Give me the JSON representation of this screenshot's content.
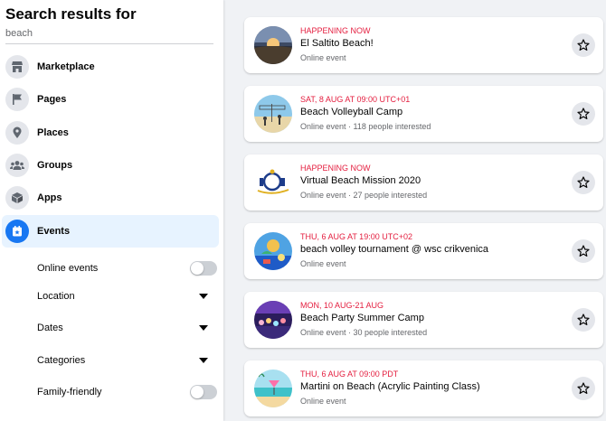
{
  "sidebar": {
    "title": "Search results for",
    "query": "beach",
    "nav": [
      {
        "label": "Marketplace",
        "icon": "store-icon"
      },
      {
        "label": "Pages",
        "icon": "flag-icon"
      },
      {
        "label": "Places",
        "icon": "map-pin-icon"
      },
      {
        "label": "Groups",
        "icon": "groups-icon"
      },
      {
        "label": "Apps",
        "icon": "cube-icon"
      },
      {
        "label": "Events",
        "icon": "calendar-star-icon",
        "active": true
      }
    ],
    "filters": {
      "online_events": {
        "label": "Online events",
        "toggle": false
      },
      "location": {
        "label": "Location"
      },
      "dates": {
        "label": "Dates"
      },
      "categories": {
        "label": "Categories"
      },
      "family_friendly": {
        "label": "Family-friendly",
        "toggle": false
      }
    }
  },
  "events": [
    {
      "date": "HAPPENING NOW",
      "title": "El Saltito Beach!",
      "meta": "Online event",
      "thumb": "sunset-beach"
    },
    {
      "date": "SAT, 8 AUG AT 09:00 UTC+01",
      "title": "Beach Volleyball Camp",
      "meta": "Online event · 118 people interested",
      "thumb": "volleyball-beach"
    },
    {
      "date": "HAPPENING NOW",
      "title": "Virtual Beach Mission 2020",
      "meta": "Online event · 27 people interested",
      "thumb": "mission-logo"
    },
    {
      "date": "THU, 6 AUG AT 19:00 UTC+02",
      "title": "beach volley tournament @ wsc crikvenica",
      "meta": "Online event",
      "thumb": "beach-cartoon"
    },
    {
      "date": "MON, 10 AUG-21 AUG",
      "title": "Beach Party Summer Camp",
      "meta": "Online event · 30 people interested",
      "thumb": "party-crowd"
    },
    {
      "date": "THU, 6 AUG AT 09:00 PDT",
      "title": "Martini on Beach (Acrylic Painting Class)",
      "meta": "Online event",
      "thumb": "painting-martini"
    }
  ],
  "colors": {
    "accent": "#1877f2",
    "date_red": "#e41e3f",
    "background": "#f0f2f5"
  }
}
